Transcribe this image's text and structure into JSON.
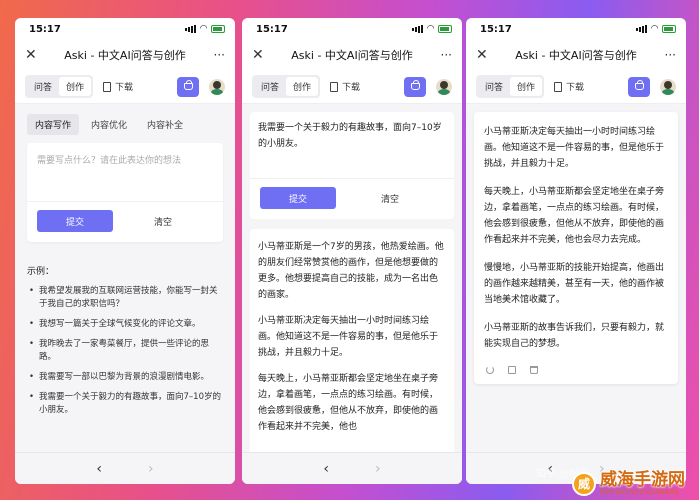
{
  "status": {
    "time": "15:17"
  },
  "header": {
    "title": "Aski - 中文AI问答与创作",
    "close": "✕",
    "more": "···"
  },
  "toolbar": {
    "tab_qa": "问答",
    "tab_create": "创作",
    "download": "下载"
  },
  "phone1": {
    "subtabs": [
      "内容写作",
      "内容优化",
      "内容补全"
    ],
    "input_placeholder": "需要写点什么？请在此表达你的想法",
    "submit": "提交",
    "clear": "清空",
    "examples_title": "示例：",
    "examples": [
      "我希望发展我的互联网运营技能，你能写一封关于我自己的求职信吗？",
      "我想写一篇关于全球气候变化的评论文章。",
      "我昨晚去了一家粤菜餐厅，提供一些评论的思路。",
      "我需要写一部以巴黎为背景的浪漫剧情电影。",
      "我需要一个关于毅力的有趣故事，面向7–10岁的小朋友。"
    ]
  },
  "phone2": {
    "prompt": "我需要一个关于毅力的有趣故事，面向7–10岁的小朋友。",
    "submit": "提交",
    "clear": "清空",
    "paragraphs": [
      "小马蒂亚斯是一个7岁的男孩，他热爱绘画。他的朋友们经常赞赏他的画作，但是他想要做的更多。他想要提高自己的技能，成为一名出色的画家。",
      "小马蒂亚斯决定每天抽出一小时时间练习绘画。他知道这不是一件容易的事，但是他乐于挑战，并且毅力十足。",
      "每天晚上，小马蒂亚斯都会坚定地坐在桌子旁边，拿着画笔，一点点的练习绘画。有时候，他会感到很疲惫，但他从不放弃，即使他的画作看起来并不完美，他也"
    ]
  },
  "phone3": {
    "paragraphs": [
      "小马蒂亚斯决定每天抽出一小时时间练习绘画。他知道这不是一件容易的事，但是他乐于挑战，并且毅力十足。",
      "每天晚上，小马蒂亚斯都会坚定地坐在桌子旁边，拿着画笔，一点点的练习绘画。有时候，他会感到很疲惫，但他从不放弃，即使他的画作看起来并不完美，他也会尽力去完成。",
      "慢慢地，小马蒂亚斯的技能开始提高，他画出的画作越来越精美，甚至有一天，他的画作被当地美术馆收藏了。",
      "小马蒂亚斯的故事告诉我们，只要有毅力，就能实现自己的梦想。"
    ]
  },
  "nav": {
    "back": "‹",
    "forward": "›"
  },
  "watermark": {
    "faint": "知乎 @啦啦",
    "cn": "威海手游网",
    "en": "WEIHAISHOUYOUWANG",
    "logo": "威"
  },
  "colors": {
    "accent": "#6f6ff3"
  }
}
